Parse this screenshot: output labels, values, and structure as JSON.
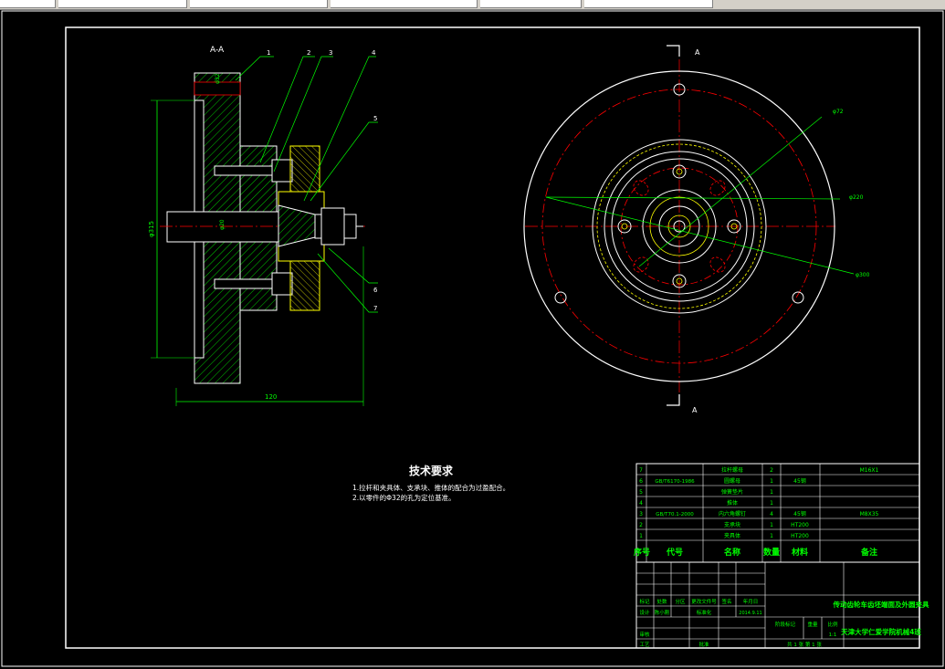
{
  "section_label": "A-A",
  "view_marker_top": "A",
  "view_marker_bottom": "A",
  "callouts": [
    "1",
    "2",
    "3",
    "4",
    "5",
    "6",
    "7"
  ],
  "dimensions": {
    "overall_width": "120",
    "left_diameter": "φ315",
    "bore_1": "φ32",
    "bore_2": "φ20",
    "pitch_1": "φ72",
    "pitch_2": "φ220",
    "pitch_3": "φ300"
  },
  "tech_requirements": {
    "title": "技术要求",
    "items": [
      "1.拉杆和夹具体、支承块、推体的配合为过盈配合。",
      "2.以零件的Φ32的孔为定位基准。"
    ]
  },
  "parts": [
    {
      "no": "7",
      "code": "",
      "name": "拉杆螺母",
      "qty": "2",
      "material": "",
      "remark": "M16X1"
    },
    {
      "no": "6",
      "code": "GB/T6170-1986",
      "name": "圆螺母",
      "qty": "1",
      "material": "45钢",
      "remark": ""
    },
    {
      "no": "5",
      "code": "",
      "name": "弹簧垫片",
      "qty": "1",
      "material": "",
      "remark": ""
    },
    {
      "no": "4",
      "code": "",
      "name": "推体",
      "qty": "1",
      "material": "",
      "remark": ""
    },
    {
      "no": "3",
      "code": "GB/T70.1-2000",
      "name": "内六角螺钉",
      "qty": "4",
      "material": "45钢",
      "remark": "M8X35"
    },
    {
      "no": "2",
      "code": "",
      "name": "支承块",
      "qty": "1",
      "material": "HT200",
      "remark": ""
    },
    {
      "no": "1",
      "code": "",
      "name": "夹具体",
      "qty": "1",
      "material": "HT200",
      "remark": ""
    }
  ],
  "parts_header": {
    "no": "序号",
    "code": "代号",
    "name": "名称",
    "qty": "数量",
    "material": "材料",
    "remark": "备注"
  },
  "title_block": {
    "drawing_title": "传动齿轮车齿坯端面及外圆夹具",
    "school": "天津大学仁爱学院机械4班",
    "scale": "1:1",
    "sheets": "共 1 张 第 1 张",
    "stage_label": "阶段标记",
    "weight_label": "重量",
    "scale_label": "比例",
    "date": "2014.9.11",
    "rows": [
      {
        "a": "标记",
        "b": "处数",
        "c": "分区",
        "d": "更改文件号",
        "e": "签名",
        "f": "年月日"
      },
      {
        "a": "设计",
        "b": "陈小刚",
        "c": "",
        "d": "标准化",
        "e": "",
        "f": "2014.9.11"
      },
      {
        "a": "审核",
        "b": "",
        "c": "",
        "d": "",
        "e": "",
        "f": ""
      },
      {
        "a": "工艺",
        "b": "",
        "c": "",
        "d": "批准",
        "e": "",
        "f": ""
      }
    ]
  },
  "colors": {
    "green": "#00ff00",
    "yellow": "#ffff00",
    "red": "#ff0000",
    "white": "#ffffff",
    "cyan": "#00ffff"
  }
}
